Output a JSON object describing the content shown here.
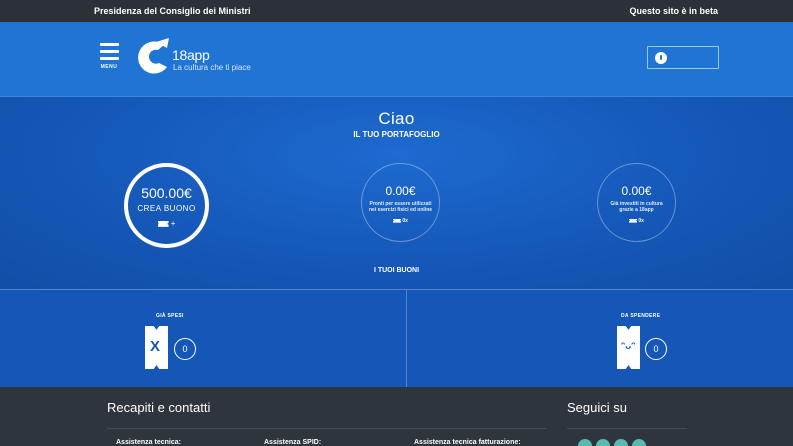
{
  "topbar": {
    "government": "Presidenza del Consiglio dei Ministri",
    "beta": "Questo sito è in beta"
  },
  "header": {
    "menu_label": "MENU",
    "brand": "18app",
    "tagline": "La cultura che ti piace"
  },
  "hero": {
    "greeting": "Ciao",
    "wallet_title": "IL TUO PORTAFOGLIO",
    "balance": {
      "amount": "500.00€",
      "action": "CREA BUONO",
      "icon": "ticket-plus-icon",
      "plus": "+"
    },
    "ready": {
      "amount": "0.00€",
      "description": "Pronti per essere utilizzati nei esercizi fisici ed online",
      "count": "0x",
      "icon": "ticket-icon"
    },
    "invested": {
      "amount": "0.00€",
      "description": "Già investiti in cultura grazie a 18app",
      "count": "0x",
      "icon": "ticket-icon"
    },
    "vouchers_link": "I TUOI BUONI"
  },
  "summary": {
    "spent": {
      "label": "GIÀ SPESI",
      "count": "0",
      "icon": "spent-ticket-icon",
      "mark": "X"
    },
    "to_spend": {
      "label": "DA SPENDERE",
      "count": "0",
      "icon": "smiling-ticket-icon",
      "mark": "ᵔᴗᵔ"
    }
  },
  "footer": {
    "contacts_title": "Recapiti e contatti",
    "social_title": "Seguici su",
    "assistance": [
      "Assistenza tecnica:",
      "Assistenza SPID:",
      "Assistenza tecnica fatturazione:"
    ],
    "social_icons": [
      "facebook-icon",
      "instagram-icon",
      "twitter-icon",
      "youtube-icon"
    ]
  },
  "colors": {
    "topbar": "#2c3138",
    "header": "#1f74d4",
    "hero": "#1558b8",
    "footer": "#2f353c",
    "social": "#59b9b3"
  }
}
